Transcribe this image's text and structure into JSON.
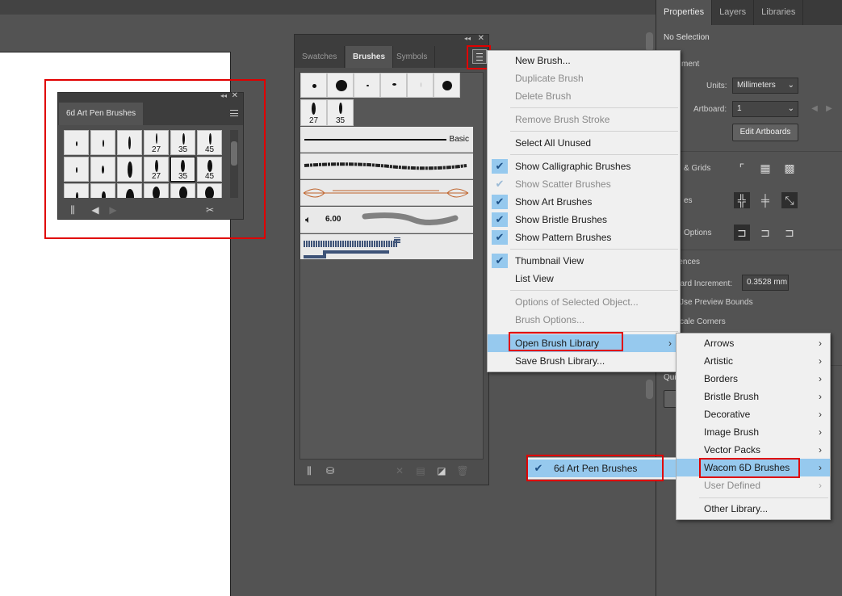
{
  "colors": {
    "accent": "#96c9ee",
    "highlight_box": "#e00000",
    "panel_bg": "#535353",
    "menu_bg": "#f0f0f0"
  },
  "properties_panel": {
    "tabs": [
      "Properties",
      "Layers",
      "Libraries"
    ],
    "no_selection": "No Selection",
    "section_document": "ment",
    "units_label": "Units:",
    "units_value": "Millimeters",
    "artboard_label": "Artboard:",
    "artboard_value": "1",
    "edit_artboards": "Edit Artboards",
    "grids_label": "& Grids",
    "guides_label": "es",
    "snap_options_label": "Options",
    "preferences_label": "rences",
    "keyboard_increment_label": "oard Increment:",
    "keyboard_increment_value": "0.3528 mm",
    "use_preview_bounds": "Jse Preview Bounds",
    "scale_corners": "cale Corners",
    "quick_label": "Qui"
  },
  "library_panel": {
    "tab_label": "6d Art Pen Brushes",
    "numbers": [
      "27",
      "35",
      "45",
      "27",
      "35",
      "45"
    ]
  },
  "brushes_panel": {
    "tabs": [
      "Swatches",
      "Brushes",
      "Symbols"
    ],
    "cell_numbers": [
      "27",
      "35"
    ],
    "basic_label": "Basic",
    "bristle_size": "6.00"
  },
  "flyout_menu": {
    "items": [
      {
        "label": "New Brush...",
        "disabled": false
      },
      {
        "label": "Duplicate Brush",
        "disabled": true
      },
      {
        "label": "Delete Brush",
        "disabled": true
      },
      {
        "label": "Remove Brush Stroke",
        "disabled": true
      },
      {
        "label": "Select All Unused",
        "disabled": false
      },
      {
        "label": "Show Calligraphic Brushes",
        "disabled": false,
        "checked": true
      },
      {
        "label": "Show Scatter Brushes",
        "disabled": true,
        "checked": true
      },
      {
        "label": "Show Art Brushes",
        "disabled": false,
        "checked": true
      },
      {
        "label": "Show Bristle Brushes",
        "disabled": false,
        "checked": true
      },
      {
        "label": "Show Pattern Brushes",
        "disabled": false,
        "checked": true
      },
      {
        "label": "Thumbnail View",
        "disabled": false,
        "checked": true
      },
      {
        "label": "List View",
        "disabled": false
      },
      {
        "label": "Options of Selected Object...",
        "disabled": true
      },
      {
        "label": "Brush Options...",
        "disabled": true
      },
      {
        "label": "Open Brush Library",
        "disabled": false,
        "highlighted": true
      },
      {
        "label": "Save Brush Library...",
        "disabled": false
      }
    ]
  },
  "library_submenu": {
    "items": [
      {
        "label": "Arrows"
      },
      {
        "label": "Artistic"
      },
      {
        "label": "Borders"
      },
      {
        "label": "Bristle Brush"
      },
      {
        "label": "Decorative"
      },
      {
        "label": "Image Brush"
      },
      {
        "label": "Vector Packs"
      },
      {
        "label": "Wacom 6D Brushes",
        "highlighted": true
      },
      {
        "label": "User Defined",
        "disabled": true
      },
      {
        "label": "Other Library..."
      }
    ]
  },
  "wacom_submenu": {
    "item": "6d Art Pen Brushes"
  }
}
